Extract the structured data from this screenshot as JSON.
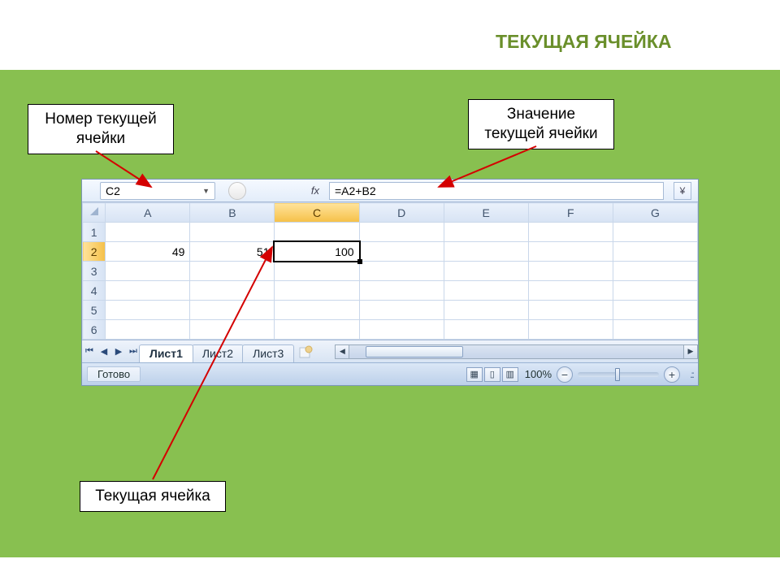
{
  "title": "ТЕКУЩАЯ ЯЧЕЙКА",
  "callouts": {
    "name_box": "Номер текущей\nячейки",
    "formula_value": "Значение\nтекущей ячейки",
    "active_cell": "Текущая ячейка"
  },
  "formula_bar": {
    "name_box_value": "C2",
    "fx_label": "fx",
    "formula_value": "=A2+B2"
  },
  "columns": [
    "A",
    "B",
    "C",
    "D",
    "E",
    "F",
    "G"
  ],
  "rows": [
    "1",
    "2",
    "3",
    "4",
    "5",
    "6"
  ],
  "selected_column": "C",
  "selected_row": "2",
  "cells": {
    "A2": "49",
    "B2": "51",
    "C2": "100"
  },
  "tabs": {
    "sheet1": "Лист1",
    "sheet2": "Лист2",
    "sheet3": "Лист3"
  },
  "status": {
    "ready": "Готово",
    "zoom": "100%"
  }
}
